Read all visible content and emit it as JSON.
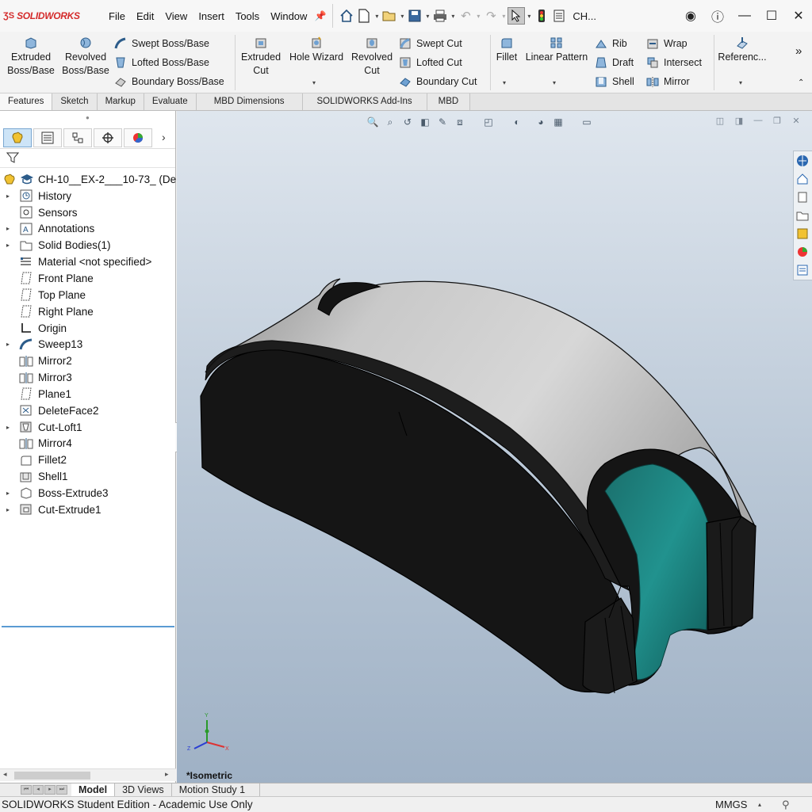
{
  "app": {
    "brand": "SOLIDWORKS",
    "document_name": "CH..."
  },
  "menu": [
    "File",
    "Edit",
    "View",
    "Insert",
    "Tools",
    "Window"
  ],
  "ribbon": {
    "extruded_boss": [
      "Extruded",
      "Boss/Base"
    ],
    "revolved_boss": [
      "Revolved",
      "Boss/Base"
    ],
    "swept_boss": "Swept Boss/Base",
    "lofted_boss": "Lofted Boss/Base",
    "boundary_boss": "Boundary Boss/Base",
    "extruded_cut": [
      "Extruded",
      "Cut"
    ],
    "hole_wizard": "Hole Wizard",
    "revolved_cut": [
      "Revolved",
      "Cut"
    ],
    "swept_cut": "Swept Cut",
    "lofted_cut": "Lofted Cut",
    "boundary_cut": "Boundary Cut",
    "fillet": "Fillet",
    "linear_pattern": "Linear Pattern",
    "rib": "Rib",
    "draft": "Draft",
    "shell": "Shell",
    "wrap": "Wrap",
    "intersect": "Intersect",
    "mirror": "Mirror",
    "reference": "Referenc...",
    "more": "»"
  },
  "tabs": [
    "Features",
    "Sketch",
    "Markup",
    "Evaluate",
    "MBD Dimensions",
    "SOLIDWORKS Add-Ins",
    "MBD"
  ],
  "active_tab": "Features",
  "tree": {
    "root": "CH-10__EX-2___10-73_ (De",
    "items": [
      {
        "label": "History",
        "icon": "history-icon",
        "expandable": true
      },
      {
        "label": "Sensors",
        "icon": "sensor-icon",
        "expandable": false
      },
      {
        "label": "Annotations",
        "icon": "annotation-icon",
        "expandable": true
      },
      {
        "label": "Solid Bodies(1)",
        "icon": "solid-bodies-icon",
        "expandable": true
      },
      {
        "label": "Material <not specified>",
        "icon": "material-icon",
        "expandable": false
      },
      {
        "label": "Front Plane",
        "icon": "plane-icon",
        "expandable": false
      },
      {
        "label": "Top Plane",
        "icon": "plane-icon",
        "expandable": false
      },
      {
        "label": "Right Plane",
        "icon": "plane-icon",
        "expandable": false
      },
      {
        "label": "Origin",
        "icon": "origin-icon",
        "expandable": false
      },
      {
        "label": "Sweep13",
        "icon": "sweep-icon",
        "expandable": true
      },
      {
        "label": "Mirror2",
        "icon": "mirror-icon",
        "expandable": false
      },
      {
        "label": "Mirror3",
        "icon": "mirror-icon",
        "expandable": false
      },
      {
        "label": "Plane1",
        "icon": "plane-icon",
        "expandable": false
      },
      {
        "label": "DeleteFace2",
        "icon": "delete-face-icon",
        "expandable": false
      },
      {
        "label": "Cut-Loft1",
        "icon": "cut-loft-icon",
        "expandable": true
      },
      {
        "label": "Mirror4",
        "icon": "mirror-icon",
        "expandable": false
      },
      {
        "label": "Fillet2",
        "icon": "fillet-icon",
        "expandable": false
      },
      {
        "label": "Shell1",
        "icon": "shell-icon",
        "expandable": false
      },
      {
        "label": "Boss-Extrude3",
        "icon": "boss-extrude-icon",
        "expandable": true
      },
      {
        "label": "Cut-Extrude1",
        "icon": "cut-extrude-icon",
        "expandable": true
      }
    ]
  },
  "viewport": {
    "view_name": "*Isometric",
    "triad_labels": {
      "x": "X",
      "y": "Y",
      "z": "Z"
    }
  },
  "bottom_tabs": [
    "Model",
    "3D Views",
    "Motion Study 1"
  ],
  "active_bottom_tab": "Model",
  "status": {
    "text": "SOLIDWORKS Student Edition - Academic Use Only",
    "units": "MMGS"
  },
  "colors": {
    "brand_red": "#d42b2b",
    "body_black": "#161616",
    "surface_gray": "#b9b9b9",
    "cut_teal": "#1f8e8a"
  }
}
